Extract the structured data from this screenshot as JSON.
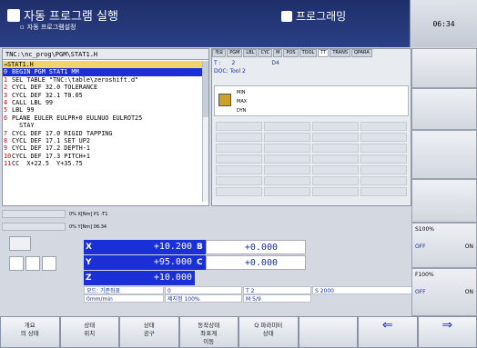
{
  "header": {
    "mode": "자동 프로그램 실행",
    "submode": "자동 프로그램설정",
    "program_mode": "프로그래밍",
    "clock": "06:34"
  },
  "program": {
    "path": "TNC:\\nc_prog\\PGM\\STAT1.H",
    "current": "→STAT1.H",
    "lines": [
      {
        "n": "0",
        "t": "BEGIN PGM STAT1 MM"
      },
      {
        "n": "1",
        "t": "SEL TABLE \"TNC:\\table\\zeroshift.d\""
      },
      {
        "n": "2",
        "t": "CYCL DEF 32.0 TOLERANCE"
      },
      {
        "n": "3",
        "t": "CYCL DEF 32.1 T0.05"
      },
      {
        "n": "4",
        "t": "CALL LBL 99"
      },
      {
        "n": "5",
        "t": "LBL 99"
      },
      {
        "n": "6",
        "t": "PLANE EULER EULPR+0 EULNUO EULROT25"
      },
      {
        "n": "",
        "t": "  STAY"
      },
      {
        "n": "7",
        "t": "CYCL DEF 17.0 RIGID TAPPING"
      },
      {
        "n": "8",
        "t": "CYCL DEF 17.1 SET UP2"
      },
      {
        "n": "9",
        "t": "CYCL DEF 17.2 DEPTH-1"
      },
      {
        "n": "10",
        "t": "CYCL DEF 17.3 PITCH+1"
      },
      {
        "n": "11",
        "t": "CC  X+22.5  Y+35.75"
      }
    ]
  },
  "tabs": [
    "개요",
    "PGM",
    "LBL",
    "CYC",
    "M",
    "POS",
    "TOOL",
    "TT",
    "TRANS",
    "QPARA"
  ],
  "tool": {
    "t_label": "T :",
    "t_value": "2",
    "t_extra": "D4",
    "doc": "DOC: Tool 2",
    "rows": [
      "MIN",
      "MAX",
      "DYN"
    ]
  },
  "progress": {
    "x": "0% X[Nm] P1  -T1",
    "y": "0% Y[Nm] 06:34"
  },
  "axes": [
    {
      "name": "X",
      "value": "+10.200",
      "name2": "B",
      "value2": "+0.000"
    },
    {
      "name": "Y",
      "value": "+95.000",
      "name2": "C",
      "value2": "+0.000"
    },
    {
      "name": "Z",
      "value": "+10.000"
    }
  ],
  "status": {
    "mode": "모드: 기준좌표",
    "offset": "0",
    "tool": "T 2",
    "spindle": "S 2000",
    "feed": "0mm/min",
    "override": "제지정 100%",
    "m": "M 5/9"
  },
  "side": {
    "s_override": "S100%",
    "f_override": "F100%",
    "off": "OFF",
    "on": "ON"
  },
  "softkeys": [
    {
      "l1": "개요",
      "l2": "의 상태"
    },
    {
      "l1": "상태",
      "l2": "위치"
    },
    {
      "l1": "상태",
      "l2": "공구"
    },
    {
      "l1": "동작상태",
      "l2": "좌표계",
      "l3": "이동"
    },
    {
      "l1": "Q 파라미터",
      "l2": "상태"
    },
    {
      "l1": "",
      "l2": ""
    },
    {
      "l1": "",
      "l2": ""
    },
    {
      "l1": "",
      "l2": ""
    }
  ]
}
